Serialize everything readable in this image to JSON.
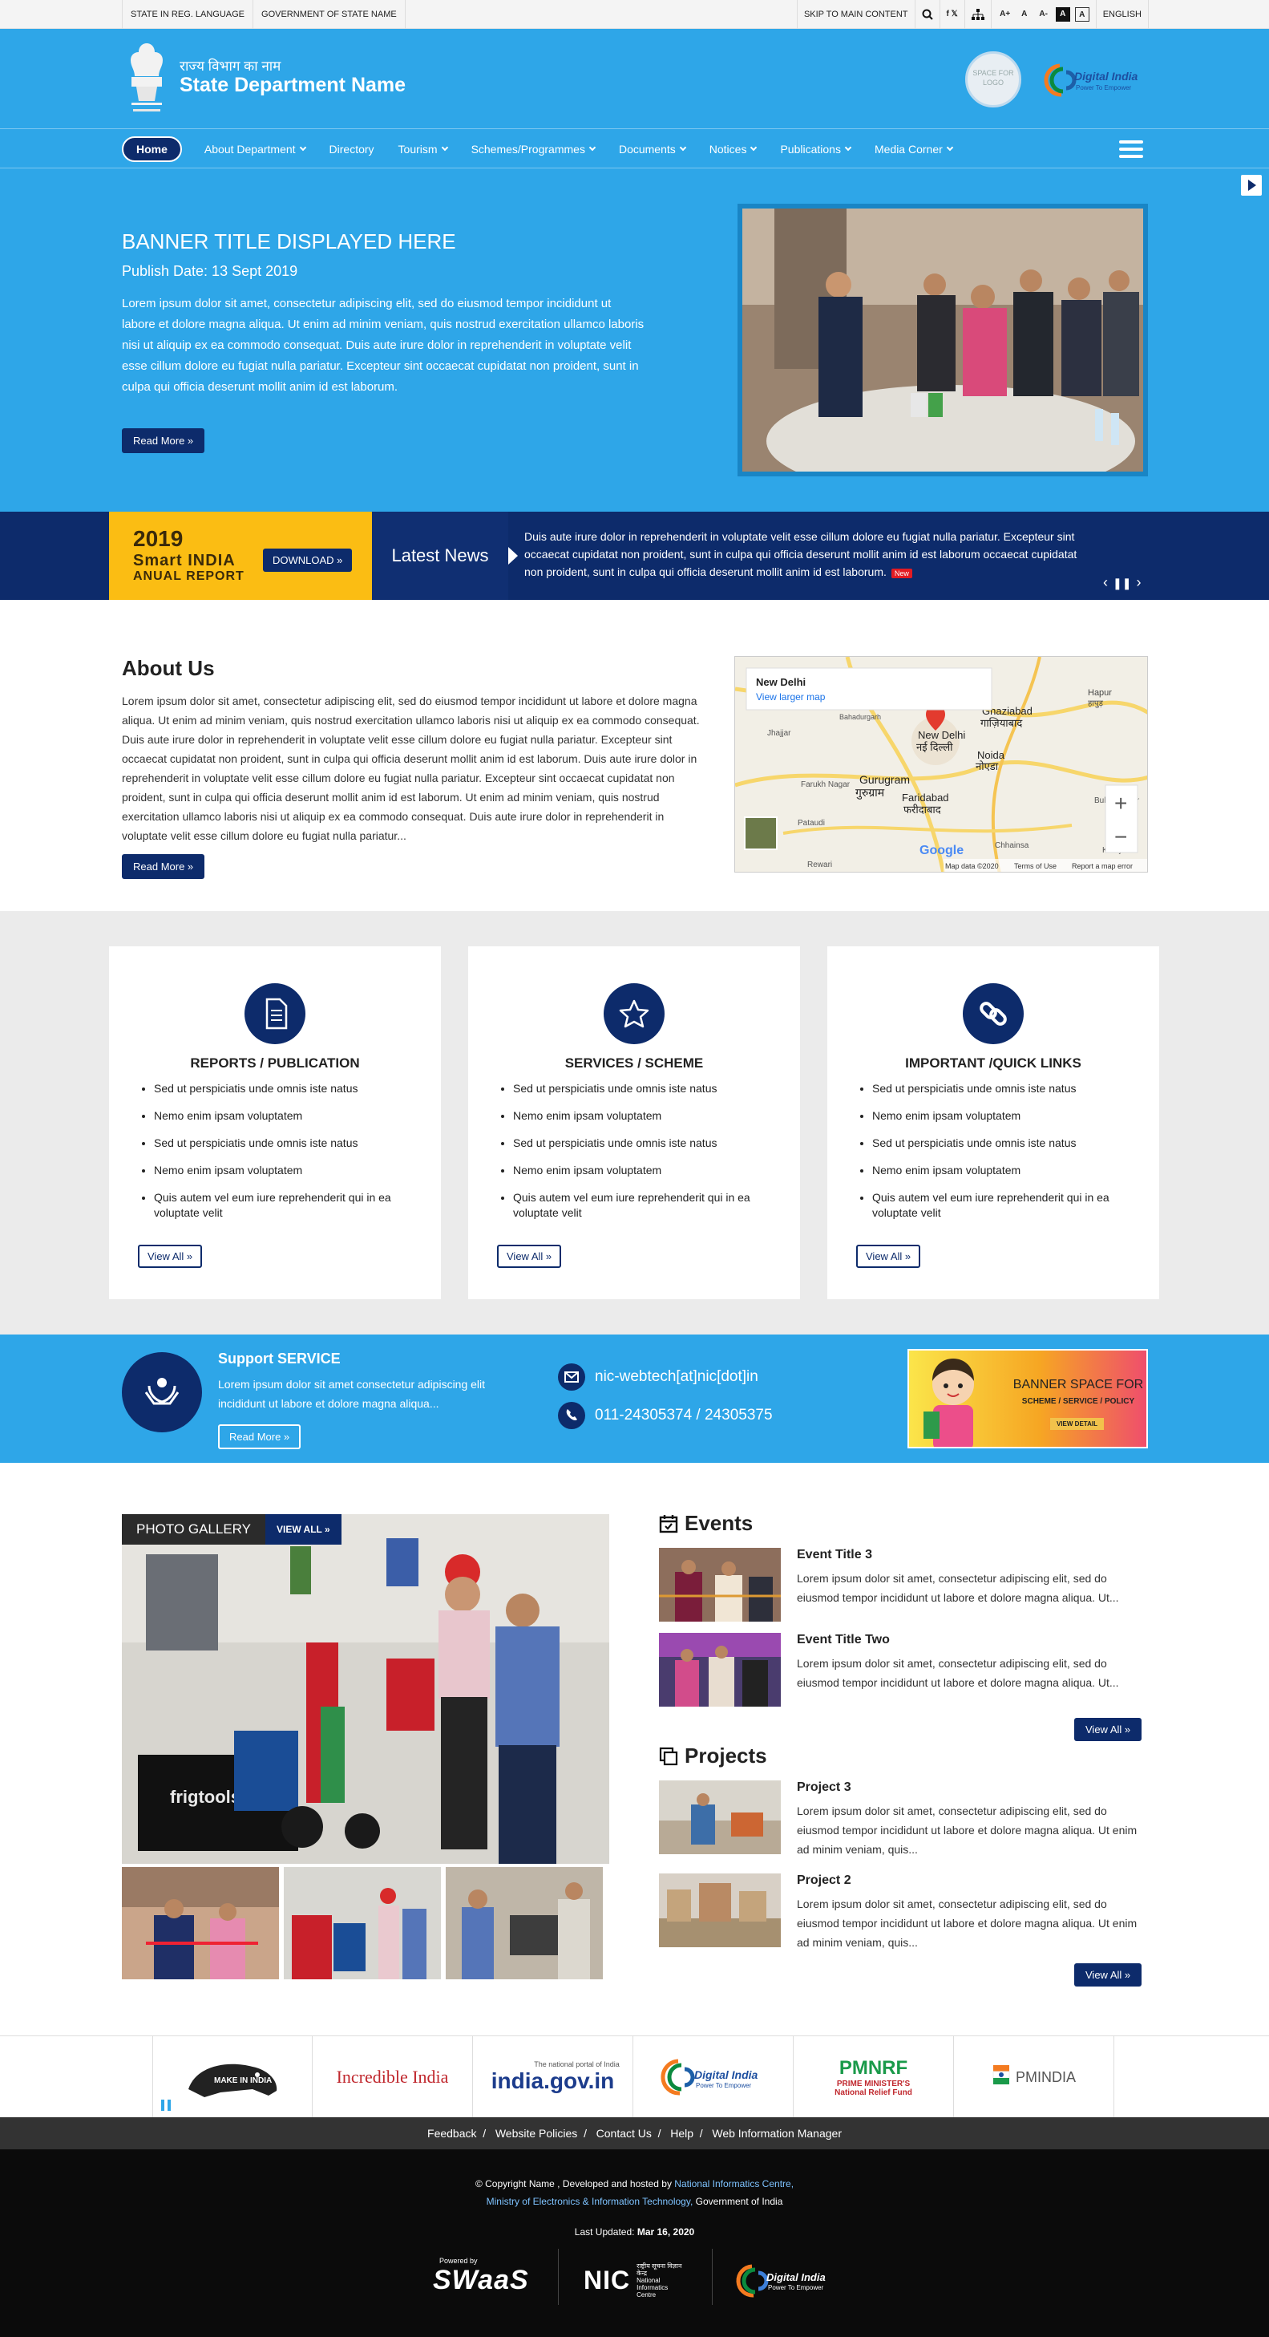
{
  "topbar": {
    "left": [
      "STATE IN REG. LANGUAGE",
      "GOVERNMENT OF STATE NAME"
    ],
    "skip": "SKIP TO MAIN CONTENT",
    "font_sizes": [
      "A+",
      "A",
      "A-"
    ],
    "contrast": [
      "A",
      "A"
    ],
    "language": "ENGLISH"
  },
  "header": {
    "hindi_name": "राज्य विभाग का नाम",
    "dept_name": "State Department Name",
    "space_logo": "SPACE FOR LOGO",
    "digital_india": "Digital India",
    "digital_india_tag": "Power To Empower"
  },
  "nav": {
    "items": [
      "Home",
      "About Department",
      "Directory",
      "Tourism",
      "Schemes/Programmes",
      "Documents",
      "Notices",
      "Publications",
      "Media Corner"
    ]
  },
  "banner": {
    "title": "BANNER TITLE DISPLAYED HERE",
    "date": "Publish Date: 13 Sept 2019",
    "text": "Lorem ipsum dolor sit amet, consectetur adipiscing elit, sed do eiusmod tempor incididunt ut labore et dolore magna aliqua. Ut enim ad minim veniam, quis nostrud exercitation ullamco laboris nisi ut aliquip ex ea commodo consequat. Duis aute irure dolor in reprehenderit in voluptate velit esse cillum dolore eu fugiat nulla pariatur. Excepteur sint occaecat cupidatat non proident, sunt in culpa qui officia deserunt mollit anim id est laborum.",
    "read_more": "Read More »"
  },
  "annual": {
    "year": "2019",
    "line1": "Smart INDIA",
    "line2": "ANUAL REPORT",
    "download": "DOWNLOAD »"
  },
  "news": {
    "label": "Latest News",
    "text": "Duis aute irure dolor in reprehenderit in voluptate velit esse cillum dolore eu fugiat nulla pariatur. Excepteur sint occaecat cupidatat non proident, sunt in culpa qui officia deserunt mollit anim id est laborum occaecat cupidatat non proident, sunt in culpa qui officia deserunt mollit anim id est laborum.",
    "badge": "New"
  },
  "about": {
    "title": "About Us",
    "text": "Lorem ipsum dolor sit amet, consectetur adipiscing elit, sed do eiusmod tempor incididunt ut labore et dolore magna aliqua. Ut enim ad minim veniam, quis nostrud exercitation ullamco laboris nisi ut aliquip ex ea commodo consequat. Duis aute irure dolor in reprehenderit in voluptate velit esse cillum dolore eu fugiat nulla pariatur. Excepteur sint occaecat cupidatat non proident, sunt in culpa qui officia deserunt mollit anim id est laborum. Duis aute irure dolor in reprehenderit in voluptate velit esse cillum dolore eu fugiat nulla pariatur. Excepteur sint occaecat cupidatat non proident, sunt in culpa qui officia deserunt mollit anim id est laborum. Ut enim ad minim veniam, quis nostrud exercitation ullamco laboris nisi ut aliquip ex ea commodo consequat. Duis aute irure dolor in reprehenderit in voluptate velit esse cillum dolore eu fugiat nulla pariatur...",
    "read_more": "Read More »"
  },
  "map": {
    "place": "New Delhi",
    "larger": "View larger map",
    "labels": [
      "Ghaziabad",
      "गाज़ियाबाद",
      "New Delhi",
      "नई दिल्ली",
      "Noida",
      "नोएडा",
      "Gurugram",
      "गुरुग्राम",
      "Faridabad",
      "फरीदाबाद",
      "Hapur",
      "हापुड़",
      "Farukh Nagar",
      "Pataudi",
      "Bahadurgarh",
      "Jhajjar",
      "Rewari",
      "Chhainsa",
      "Khurja",
      "Bulandshahr"
    ],
    "footer": [
      "Map data ©2020",
      "Terms of Use",
      "Report a map error"
    ],
    "google": "Google",
    "zoom_in": "+",
    "zoom_out": "−"
  },
  "cards": [
    {
      "title": "REPORTS / PUBLICATION",
      "items": [
        "Sed ut perspiciatis unde omnis iste natus",
        "Nemo enim ipsam voluptatem",
        "Sed ut perspiciatis unde omnis iste natus",
        "Nemo enim ipsam voluptatem",
        "Quis autem vel eum iure reprehenderit qui in ea voluptate velit"
      ],
      "view_all": "View All »"
    },
    {
      "title": "SERVICES / SCHEME",
      "items": [
        "Sed ut perspiciatis unde omnis iste natus",
        "Nemo enim ipsam voluptatem",
        "Sed ut perspiciatis unde omnis iste natus",
        "Nemo enim ipsam voluptatem",
        "Quis autem vel eum iure reprehenderit qui in ea voluptate velit"
      ],
      "view_all": "View All »"
    },
    {
      "title": "IMPORTANT /QUICK LINKS",
      "items": [
        "Sed ut perspiciatis unde omnis iste natus",
        "Nemo enim ipsam voluptatem",
        "Sed ut perspiciatis unde omnis iste natus",
        "Nemo enim ipsam voluptatem",
        "Quis autem vel eum iure reprehenderit qui in ea voluptate velit"
      ],
      "view_all": "View All »"
    }
  ],
  "support": {
    "title": "Support SERVICE",
    "text": "Lorem ipsum dolor sit amet consectetur adipiscing elit incididunt ut labore et dolore magna aliqua...",
    "read_more": "Read More »",
    "email": "nic-webtech[at]nic[dot]in",
    "phone": "011-24305374 / 24305375",
    "banner_title": "BANNER SPACE FOR",
    "banner_sub": "SCHEME / SERVICE / POLICY",
    "banner_btn": "VIEW DETAIL"
  },
  "gallery": {
    "title": "PHOTO GALLERY",
    "view_all": "VIEW ALL »",
    "brand": "frigtools"
  },
  "events": {
    "title": "Events",
    "items": [
      {
        "title": "Event Title 3",
        "text": "Lorem ipsum dolor sit amet, consectetur adipiscing elit, sed do eiusmod tempor incididunt ut labore et dolore magna aliqua. Ut..."
      },
      {
        "title": "Event Title Two",
        "text": "Lorem ipsum dolor sit amet, consectetur adipiscing elit, sed do eiusmod tempor incididunt ut labore et dolore magna aliqua. Ut..."
      }
    ],
    "view_all": "View All »"
  },
  "projects": {
    "title": "Projects",
    "items": [
      {
        "title": "Project 3",
        "text": "Lorem ipsum dolor sit amet, consectetur adipiscing elit, sed do eiusmod tempor incididunt ut labore et dolore magna aliqua. Ut enim ad minim veniam, quis..."
      },
      {
        "title": "Project 2",
        "text": "Lorem ipsum dolor sit amet, consectetur adipiscing elit, sed do eiusmod tempor incididunt ut labore et dolore magna aliqua. Ut enim ad minim veniam, quis..."
      }
    ],
    "view_all": "View All »"
  },
  "logos": {
    "make_in_india": "MAKE IN INDIA",
    "incredible_india": "Incredible India",
    "india_gov_tag": "The national portal of India",
    "india_gov": "india.gov.in",
    "digital_india": "Digital India",
    "digital_india_tag": "Power To Empower",
    "pmnrf": "PMNRF",
    "pmnrf_sub1": "PRIME MINISTER'S",
    "pmnrf_sub2": "National Relief Fund",
    "pmindia": "PMINDIA"
  },
  "footer_menu": [
    "Feedback",
    "Website Policies",
    "Contact Us",
    "Help",
    "Web Information Manager"
  ],
  "footer": {
    "copyright": "© Copyright Name , Developed and hosted by",
    "nic": "National Informatics Centre,",
    "meity": "Ministry of Electronics & Information Technology,",
    "goi": "Government of India",
    "updated_label": "Last Updated:",
    "updated_date": "Mar 16, 2020",
    "powered_by": "Powered by",
    "swaas": "SWaaS",
    "nic_logo": "NIC",
    "nic_hindi": "राष्ट्रीय सूचना विज्ञान केन्द्र",
    "nic_full": "National Informatics Centre",
    "digital_india": "Digital India",
    "digital_india_tag": "Power To Empower"
  },
  "colors": {
    "primary": "#2ea6e8",
    "dark": "#0d2b6b",
    "accent": "#fbbd13",
    "footer": "#0b0b0b"
  }
}
